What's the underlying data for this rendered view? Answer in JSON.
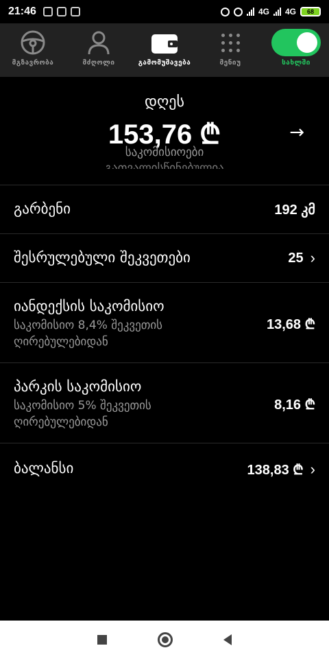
{
  "status_bar": {
    "time": "21:46",
    "network1": "4G",
    "network2": "4G",
    "battery": "68"
  },
  "nav": {
    "items": [
      {
        "label": "მგზავრობა",
        "icon": "steering-wheel-icon"
      },
      {
        "label": "მძღოლი",
        "icon": "person-icon"
      },
      {
        "label": "გამომუშავება",
        "icon": "wallet-icon"
      },
      {
        "label": "მენიუ",
        "icon": "grid-dots-icon"
      },
      {
        "label": "სახლში",
        "icon": "toggle-icon"
      }
    ]
  },
  "summary": {
    "label": "დღეს",
    "amount": "153,76 ₾",
    "sub": "საკომისიოები",
    "sub2": "გათვალისწინებულია"
  },
  "rows": [
    {
      "title": "გარბენი",
      "value": "192 კმ"
    },
    {
      "title": "შესრულებული შეკვეთები",
      "value": "25"
    },
    {
      "title": "იანდექსის საკომისიო",
      "sub": "საკომისიო 8,4% შეკვეთის ღირებულებიდან",
      "value": "13,68 ₾"
    },
    {
      "title": "პარკის საკომისიო",
      "sub": "საკომისიო 5% შეკვეთის ღირებულებიდან",
      "value": "8,16 ₾"
    },
    {
      "title": "ბალანსი",
      "value": "138,83 ₾"
    }
  ],
  "colors": {
    "accent": "#22c55e",
    "background": "#000000",
    "nav_background": "#222222",
    "muted_text": "#9a9a9a"
  }
}
